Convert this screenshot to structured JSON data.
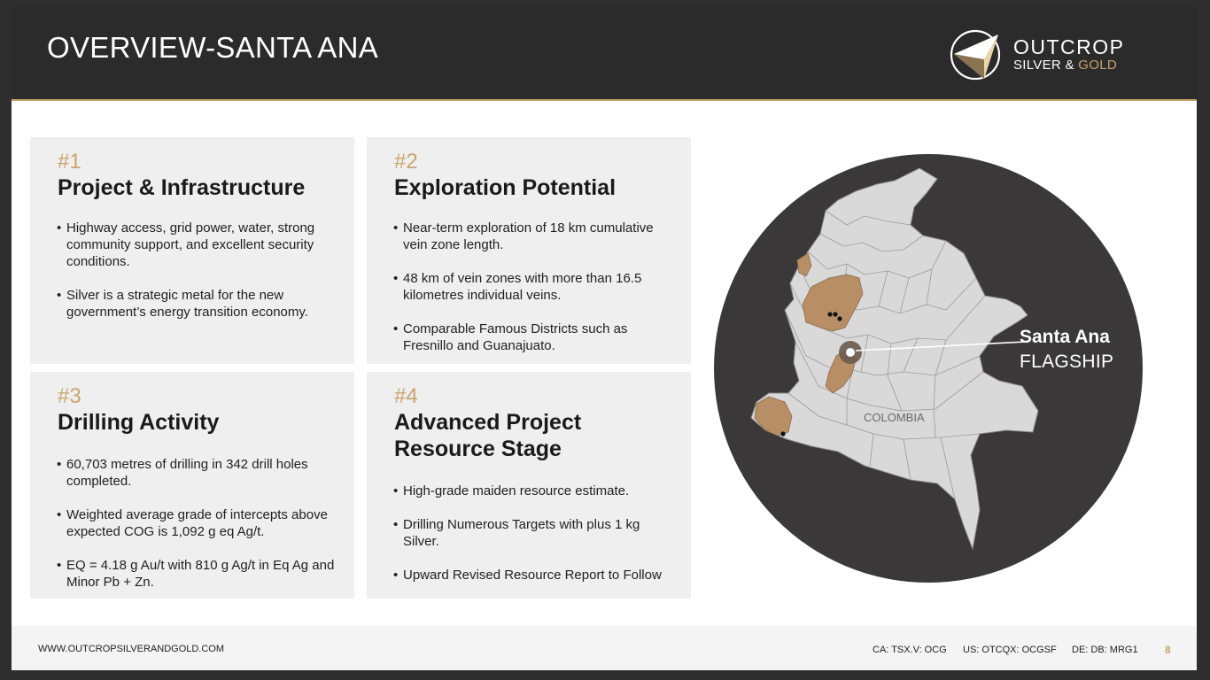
{
  "header": {
    "title": "OVERVIEW-SANTA ANA",
    "logo": {
      "line1": "OUTCROP",
      "line2_white": "SILVER & ",
      "line2_gold": "GOLD",
      "icon": "outcrop-logo-icon"
    }
  },
  "cards": [
    {
      "num": "#1",
      "title": "Project & Infrastructure",
      "bullets": [
        "Highway access, grid power, water, strong community support, and excellent security conditions.",
        "Silver is a strategic metal for the new government’s energy transition economy."
      ]
    },
    {
      "num": "#2",
      "title": "Exploration Potential",
      "bullets": [
        "Near-term exploration of 18 km cumulative vein zone length.",
        "48 km of vein zones with more than 16.5 kilometres individual veins.",
        "Comparable Famous Districts such as Fresnillo and Guanajuato."
      ]
    },
    {
      "num": "#3",
      "title": "Drilling Activity",
      "bullets": [
        "60,703 metres of drilling in 342 drill holes completed.",
        "Weighted average grade of intercepts above expected COG is 1,092 g eq Ag/t.",
        "EQ = 4.18 g Au/t with 810 g Ag/t in Eq Ag and Minor Pb + Zn."
      ]
    },
    {
      "num": "#4",
      "title_line1": "Advanced Project",
      "title_line2": "Resource Stage",
      "bullets": [
        "High-grade maiden resource estimate.",
        "Drilling Numerous Targets with plus 1 kg Silver.",
        "Upward Revised Resource Report to Follow"
      ]
    }
  ],
  "map": {
    "country_label": "COLOMBIA",
    "callout_name": "Santa Ana",
    "callout_sub": "FLAGSHIP",
    "colors": {
      "circle": "#3a3838",
      "land": "#d9d9d9",
      "highlight": "#b88f65",
      "accent": "#c8a56a"
    }
  },
  "footer": {
    "url": "WWW.OUTCROPSILVERANDGOLD.COM",
    "ticker_ca": "CA: TSX.V: OCG",
    "ticker_us": "US: OTCQX: OCGSF",
    "ticker_de": "DE: DB: MRG1",
    "page": "8"
  }
}
